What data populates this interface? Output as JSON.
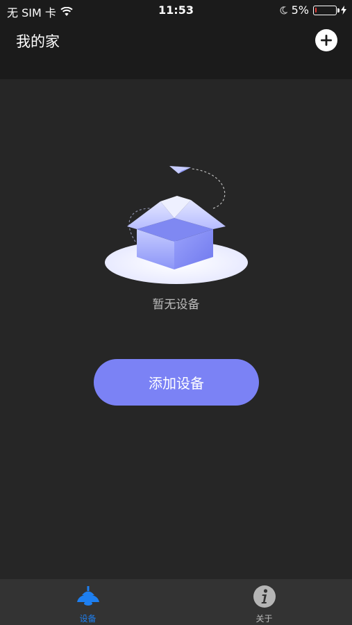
{
  "status_bar": {
    "carrier": "无 SIM 卡",
    "time": "11:53",
    "battery_percent": "5%",
    "battery_level": 0.05,
    "icons": [
      "wifi-icon",
      "moon-icon",
      "battery-icon",
      "charging-icon"
    ]
  },
  "header": {
    "title": "我的家",
    "add_icon": "plus-circle-icon"
  },
  "empty_state": {
    "illustration": "empty-box-illustration",
    "text": "暂无设备"
  },
  "actions": {
    "add_device_label": "添加设备"
  },
  "tabbar": {
    "tabs": [
      {
        "label": "设备",
        "icon": "lamp-icon",
        "active": true
      },
      {
        "label": "关于",
        "icon": "info-icon",
        "active": false
      }
    ]
  },
  "colors": {
    "background": "#262626",
    "header": "#1b1b1b",
    "accent": "#7b82f5",
    "tab_active": "#1e7ff0",
    "tab_inactive": "#bdbdbd"
  }
}
